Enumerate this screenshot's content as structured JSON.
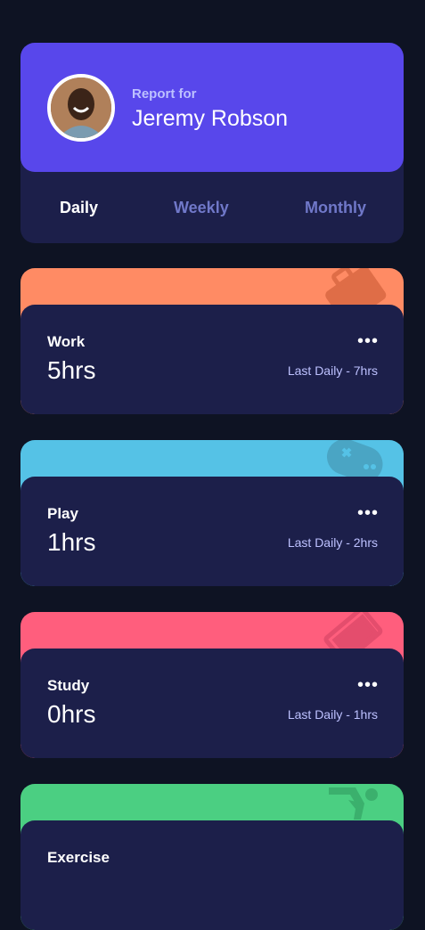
{
  "profile": {
    "report_label": "Report for",
    "name": "Jeremy Robson"
  },
  "tabs": [
    {
      "label": "Daily",
      "active": true
    },
    {
      "label": "Weekly",
      "active": false
    },
    {
      "label": "Monthly",
      "active": false
    }
  ],
  "cards": [
    {
      "title": "Work",
      "hours": "5hrs",
      "last": "Last Daily - 7hrs",
      "color": "#ff8b64",
      "icon": "briefcase-icon"
    },
    {
      "title": "Play",
      "hours": "1hrs",
      "last": "Last Daily - 2hrs",
      "color": "#55c2e6",
      "icon": "gamepad-icon"
    },
    {
      "title": "Study",
      "hours": "0hrs",
      "last": "Last Daily - 1hrs",
      "color": "#ff5e7d",
      "icon": "book-icon"
    },
    {
      "title": "Exercise",
      "color": "#4bcf82",
      "icon": "runner-icon"
    }
  ],
  "menu_glyph": "•••"
}
